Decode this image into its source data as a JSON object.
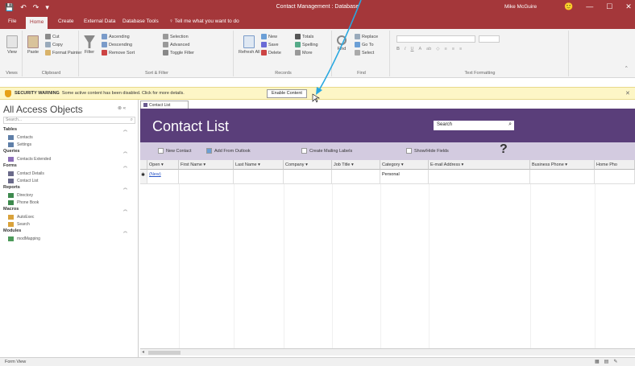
{
  "titlebar": {
    "title": "Contact Management : Database",
    "user": "Mike McGuire",
    "qat": [
      "💾",
      "↶",
      "↷",
      "▾"
    ],
    "window_controls": [
      "🙂",
      "—",
      "☐",
      "✕"
    ]
  },
  "ribbon_tabs": [
    "File",
    "Home",
    "Create",
    "External Data",
    "Database Tools",
    "♀ Tell me what you want to do"
  ],
  "ribbon": {
    "views": {
      "view": "View",
      "label": "Views"
    },
    "clipboard": {
      "paste": "Paste",
      "cut": "Cut",
      "copy": "Copy",
      "format_painter": "Format Painter",
      "label": "Clipboard"
    },
    "sort_filter": {
      "filter": "Filter",
      "ascending": "Ascending",
      "descending": "Descending",
      "remove_sort": "Remove Sort",
      "selection": "Selection",
      "advanced": "Advanced",
      "toggle_filter": "Toggle Filter",
      "label": "Sort & Filter"
    },
    "records": {
      "refresh": "Refresh All",
      "new": "New",
      "save": "Save",
      "delete": "Delete",
      "totals": "Totals",
      "spelling": "Spelling",
      "more": "More",
      "label": "Records"
    },
    "find": {
      "find": "Find",
      "replace": "Replace",
      "goto": "Go To",
      "select": "Select",
      "label": "Find"
    },
    "text_formatting": {
      "label": "Text Formatting"
    }
  },
  "security": {
    "title": "SECURITY WARNING",
    "message": "Some active content has been disabled. Click for more details.",
    "button": "Enable Content"
  },
  "nav": {
    "header": "All Access Objects",
    "search_placeholder": "Search...",
    "categories": [
      {
        "name": "Tables",
        "items": [
          "Contacts",
          "Settings"
        ]
      },
      {
        "name": "Queries",
        "items": [
          "Contacts Extended"
        ]
      },
      {
        "name": "Forms",
        "items": [
          "Contact Details",
          "Contact List"
        ]
      },
      {
        "name": "Reports",
        "items": [
          "Directory",
          "Phone Book"
        ]
      },
      {
        "name": "Macros",
        "items": [
          "AutoExec",
          "Search"
        ]
      },
      {
        "name": "Modules",
        "items": [
          "modMapping"
        ]
      }
    ]
  },
  "doc_tab": "Contact List",
  "form": {
    "title": "Contact List",
    "search_value": "Search",
    "toolbar": [
      "New Contact",
      "Add From Outlook",
      "Create Mailing Labels",
      "Show/Hide Fields"
    ],
    "help": "?"
  },
  "table": {
    "columns": [
      "Open",
      "First Name",
      "Last Name",
      "Company",
      "Job Title",
      "Category",
      "E-mail Address",
      "Business Phone",
      "Home Pho"
    ],
    "rows": [
      [
        "(New)",
        "",
        "",
        "",
        "",
        "Personal",
        "",
        "",
        ""
      ]
    ]
  },
  "statusbar": {
    "text": "Form View"
  }
}
